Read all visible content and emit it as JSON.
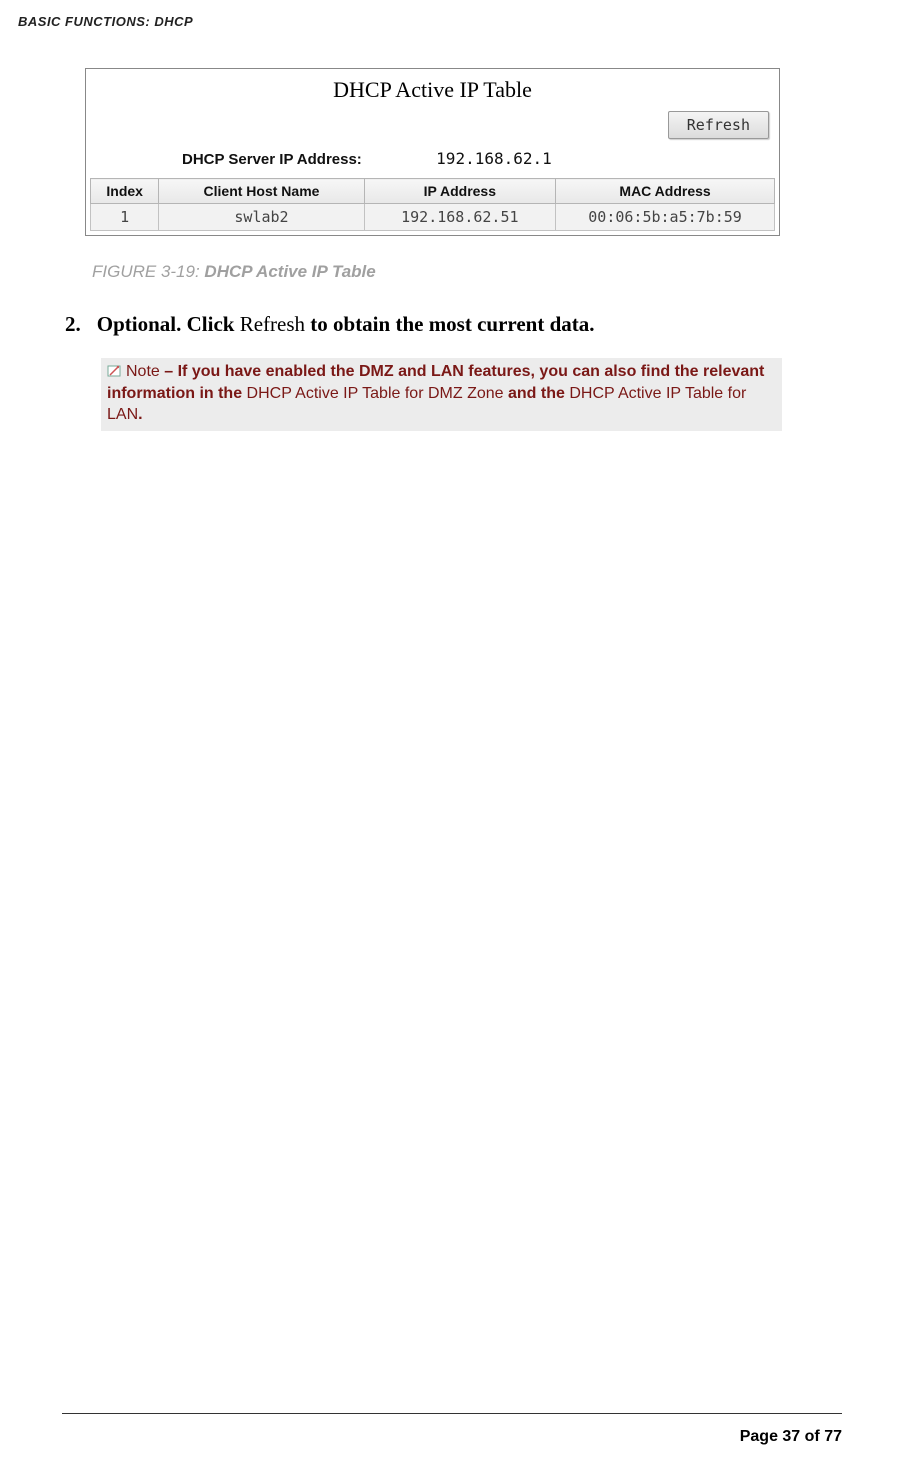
{
  "header": "BASIC FUNCTIONS: DHCP",
  "figure": {
    "title": "DHCP Active IP Table",
    "refresh": "Refresh",
    "server_label": "DHCP Server IP Address:",
    "server_ip": "192.168.62.1",
    "columns": {
      "index": "Index",
      "host": "Client Host Name",
      "ip": "IP Address",
      "mac": "MAC Address"
    },
    "rows": [
      {
        "index": "1",
        "host": "swlab2",
        "ip": "192.168.62.51",
        "mac": "00:06:5b:a5:7b:59"
      }
    ]
  },
  "caption": {
    "prefix": "FIGURE 3-19: ",
    "bold": "DHCP Active IP Table"
  },
  "step": {
    "num": "2.",
    "boldA": "Optional. Click ",
    "reg": "Refresh",
    "boldB": " to obtain the most current data."
  },
  "note": {
    "label": "Note",
    "dash": " – ",
    "b1": "If you have enabled the DMZ and LAN features, you can also find the relevant information in the ",
    "r1": "DHCP Active IP Table for DMZ Zone",
    "b2": " and the ",
    "r2": "DHCP Active IP Table for LAN",
    "b3": "."
  },
  "footer": "Page 37 of 77"
}
